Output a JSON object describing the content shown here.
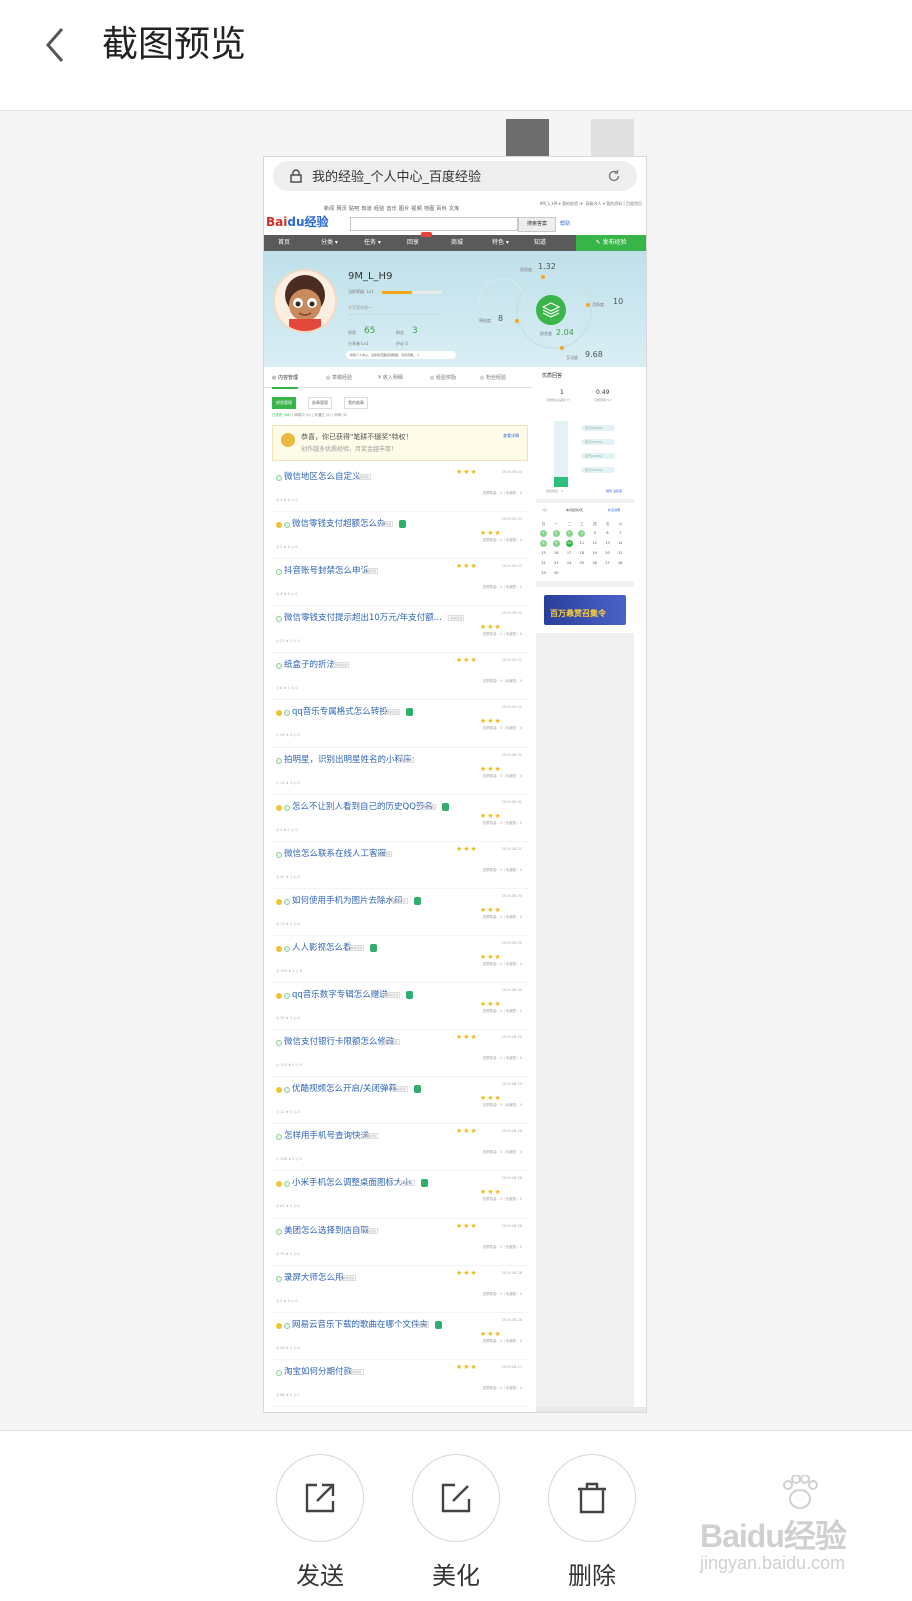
{
  "header": {
    "title": "截图预览"
  },
  "screenshot": {
    "url_bar_text": "我的经验_个人中心_百度经验",
    "logo_text": "Bai",
    "logo_paw": "du",
    "logo_suffix": "经验",
    "top_links": "新闻  网页  贴吧  知道  经验  音乐  图片  视频  地图  百科  文库",
    "user_links": "9M_L_H9 ▾  我的经验  📧  高级名人 ▾  我的资料  |  百度首页",
    "search_button": "搜索答案",
    "help_link": "帮助",
    "nav": [
      "首页",
      "分类 ▾",
      "任务 ▾",
      "回享",
      "商城",
      "特色 ▾",
      "知道"
    ],
    "nav_cta": "✎ 发布经验",
    "profile": {
      "username": "9M_L_H9",
      "level_text": "当前等级: Lv1",
      "level_progress": 0.5,
      "signature_placeholder": "写写签名吧~",
      "stats": [
        {
          "label": "经验",
          "value": "65"
        },
        {
          "label": "粉丝",
          "value": "3"
        }
      ],
      "sub_stats": [
        "分享者 Lv1",
        "评论 0"
      ],
      "tip": "新版个人中心，全新的页面经验数据，请去查看。 ×",
      "metrics": [
        {
          "label": "优质度",
          "value": "1.32"
        },
        {
          "label": "原创度",
          "value": "8"
        },
        {
          "label": "活跃度",
          "value": "10"
        },
        {
          "label": "综合度",
          "value": "2.04"
        },
        {
          "label": "互动度",
          "value": "9.68"
        }
      ]
    },
    "tabs": [
      "◎ 内容管理",
      "◎ 草稿经验",
      "¥ 收入明细",
      "◎ 经验奖励",
      "◎ 粉丝经验"
    ],
    "subtabs": [
      "经验管理",
      "勋章管理",
      "我的勋章"
    ],
    "filters": [
      "已发布 (48)",
      "审核中 (0)",
      "未通过 (0)",
      "申请 (0)"
    ],
    "congrats": {
      "line1": "恭喜，你已获得\"笔耕不辍奖\"特权！",
      "line2": "创作越多优质经验，月奖金越丰厚！",
      "link": "查看详情"
    },
    "articles": [
      {
        "title": "微信地区怎么自定义",
        "tag": "精编经验",
        "orange": false,
        "shield": false,
        "date": "2019-09-04",
        "meta": "◎ 4    ★ 0    ◎ 0",
        "rmeta": "投票数量：0 | 收藏数：0"
      },
      {
        "title": "微信零钱支付超额怎么办",
        "tag": "精编经验",
        "orange": true,
        "shield": true,
        "date": "2019-09-03",
        "meta": "◎ 2    ★ 0    ◎ 0",
        "rmeta": "投票数量：0 | 收藏数：0"
      },
      {
        "title": "抖音账号封禁怎么申诉",
        "tag": "精编经验",
        "orange": false,
        "shield": false,
        "date": "2019-09-03",
        "meta": "◎ 4    ★ 0    ◎ 0",
        "rmeta": "投票数量：0 | 收藏数：0"
      },
      {
        "title": "微信零钱支付提示超出10万元/年支付额...",
        "tag": "精编经验",
        "orange": false,
        "shield": false,
        "date": "2019-09-02",
        "meta": "◎ 21   ★ 1    ◎ 0",
        "rmeta": "投票数量：0 | 收藏数：0"
      },
      {
        "title": "纸盒子的折法",
        "tag": "精编经验",
        "orange": false,
        "shield": false,
        "date": "2019-09-02",
        "meta": "◎ 8    ★ 1    ◎ 0",
        "rmeta": "投票数量：0 | 收藏数：0"
      },
      {
        "title": "qq音乐专属格式怎么转换",
        "tag": "精编经验",
        "orange": true,
        "shield": true,
        "date": "2019-09-02",
        "meta": "◎ 43   ★ 0    ◎ 0",
        "rmeta": "投票数量：0 | 收藏数：0"
      },
      {
        "title": "拍明星，识别出明星姓名的小程序",
        "tag": "精编经验",
        "orange": false,
        "shield": false,
        "date": "2019-08-31",
        "meta": "◎ 13   ★ 3    ◎ 0",
        "rmeta": "投票数量：0 | 收藏数：0"
      },
      {
        "title": "怎么不让别人看到自己的历史QQ签名",
        "tag": "精编经验",
        "orange": true,
        "shield": true,
        "date": "2019-08-31",
        "meta": "◎ 2    ★ 2    ◎ 0",
        "rmeta": "投票数量：0 | 收藏数：0"
      },
      {
        "title": "微信怎么联系在线人工客服",
        "tag": "精编经验",
        "orange": false,
        "shield": false,
        "date": "2019-08-31",
        "meta": "◎ 47   ★ 1    ◎ 0",
        "rmeta": "投票数量：0 | 收藏数：0"
      },
      {
        "title": "如何使用手机为图片去除水印",
        "tag": "精编经验",
        "orange": true,
        "shield": true,
        "date": "2019-08-30",
        "meta": "◎ 11   ★ 0    ◎ 0",
        "rmeta": "投票数量：0 | 收藏数：0"
      },
      {
        "title": "人人影视怎么看",
        "tag": "精编经验",
        "orange": true,
        "shield": true,
        "date": "2019-08-30",
        "meta": "◎ 159  ★ 1    ◎ 0",
        "rmeta": "投票数量：0 | 收藏数：0"
      },
      {
        "title": "qq音乐数字专辑怎么赠送",
        "tag": "精编经验",
        "orange": true,
        "shield": true,
        "date": "2019-08-30",
        "meta": "◎ 10   ★ 3    ◎ 0",
        "rmeta": "投票数量：0 | 收藏数：0"
      },
      {
        "title": "微信支付银行卡限额怎么修改",
        "tag": "精编经验",
        "orange": false,
        "shield": false,
        "date": "2019-08-29",
        "meta": "◎ 123  ★ 0    ◎ 0",
        "rmeta": "投票数量：0 | 收藏数：0"
      },
      {
        "title": "优酷视频怎么开启/关闭弹幕",
        "tag": "精编经验",
        "orange": true,
        "shield": true,
        "date": "2019-08-29",
        "meta": "◎ 11   ★ 3    ◎ 0",
        "rmeta": "投票数量：0 | 收藏数：0"
      },
      {
        "title": "怎样用手机号查询快递",
        "tag": "精编经验",
        "orange": false,
        "shield": false,
        "date": "2019-08-28",
        "meta": "◎ 108  ★ 1    ◎ 0",
        "rmeta": "投票数量：0 | 收藏数：0"
      },
      {
        "title": "小米手机怎么调整桌面图标大小",
        "tag": "精编经验",
        "orange": true,
        "shield": true,
        "date": "2019-08-28",
        "meta": "◎ 62   ★ 0    ◎ 0",
        "rmeta": "投票数量：0 | 收藏数：0"
      },
      {
        "title": "美团怎么选择到店自取",
        "tag": "精编经验",
        "orange": false,
        "shield": false,
        "date": "2019-08-28",
        "meta": "◎ 70   ★ 0    ◎ 0",
        "rmeta": "投票数量：0 | 收藏数：0"
      },
      {
        "title": "录屏大师怎么用",
        "tag": "精编经验",
        "orange": false,
        "shield": false,
        "date": "2019-08-28",
        "meta": "◎ 2    ★ 0    ◎ 0",
        "rmeta": "投票数量：0 | 收藏数：0"
      },
      {
        "title": "网易云音乐下载的歌曲在哪个文件夹",
        "tag": "精编经验",
        "orange": true,
        "shield": true,
        "date": "2019-08-28",
        "meta": "◎ 56   ★ 1    ◎ 0",
        "rmeta": "投票数量：0 | 收藏数：0"
      },
      {
        "title": "淘宝如何分期付款",
        "tag": "精编经验",
        "orange": false,
        "shield": false,
        "date": "2019-08-27",
        "meta": "◎ 68   ★ 0    ◎ 1",
        "rmeta": "投票数量：0 | 收藏数：0"
      }
    ],
    "side": {
      "quality_title": "优质回答",
      "quality_values": [
        {
          "value": "1",
          "label": "高质量/总采纳(个)"
        },
        {
          "value": "0.49",
          "label": "高质量率(%)"
        }
      ],
      "quality_fill": 0.15,
      "pills": [
        "高于(≥90%)",
        "高于(≥75%)",
        "高于(≥50%)",
        "高于(≥40%)"
      ],
      "quality_footer_left": "我的排名：0",
      "quality_footer_right": "规则 活跃度",
      "cal_header_left": "9月",
      "cal_header_center": "本月签到4天",
      "cal_header_right": "补签说明",
      "cal_weekdays": [
        "日",
        "一",
        "二",
        "三",
        "四",
        "五",
        "六"
      ],
      "cal_days": [
        "1",
        "2",
        "3",
        "4",
        "5",
        "6",
        "7",
        "8",
        "9",
        "10",
        "11",
        "12",
        "13",
        "14",
        "15",
        "16",
        "17",
        "18",
        "19",
        "20",
        "21",
        "22",
        "23",
        "24",
        "25",
        "26",
        "27",
        "28",
        "29",
        "30"
      ],
      "ad_text": "百万悬赏召集令"
    }
  },
  "toolbar": {
    "send_label": "发送",
    "beautify_label": "美化",
    "delete_label": "删除"
  },
  "watermark": {
    "main": "Baidu经验",
    "sub": "jingyan.baidu.com"
  }
}
